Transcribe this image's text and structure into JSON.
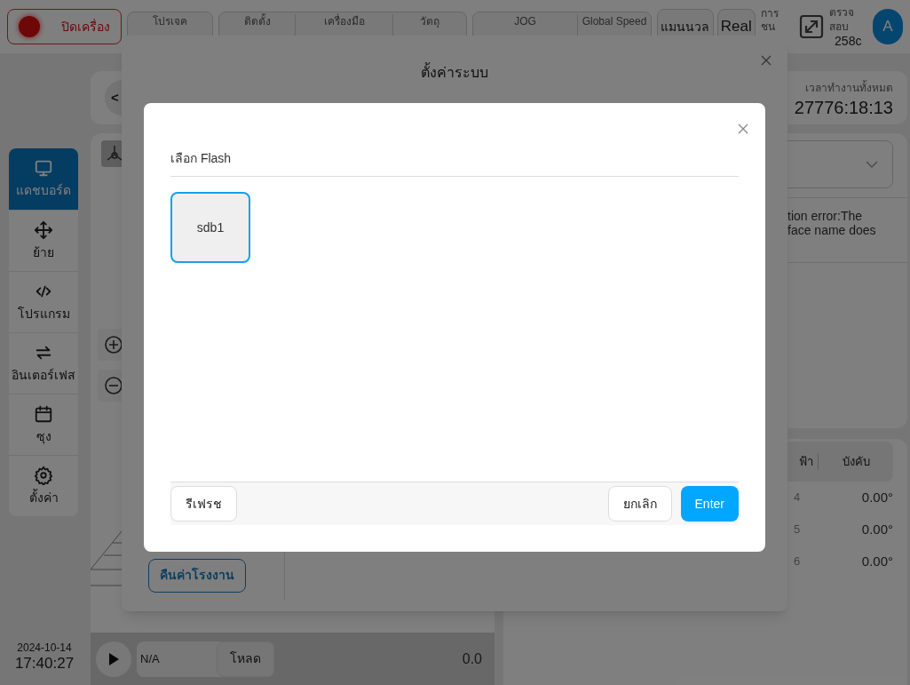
{
  "top_bar": {
    "power_button": "ปิดเครื่อง",
    "status_groups": [
      [
        {
          "label": "โปรเจค"
        }
      ],
      [
        {
          "label": "ติดตั้ง"
        },
        {
          "label": "เครื่องมือ"
        },
        {
          "label": "วัตถุ"
        }
      ],
      [
        {
          "label": "JOG"
        },
        {
          "label": "Global Speed"
        }
      ]
    ],
    "mode_button": "แมนนวล",
    "real_button": "Real",
    "collision": {
      "label": "การชน"
    },
    "inspect": {
      "label": "ตรวจสอบ",
      "value": "258c"
    },
    "avatar": "A"
  },
  "nav": [
    {
      "label": "แดชบอร์ด",
      "selected": true
    },
    {
      "label": "ย้าย",
      "selected": false
    },
    {
      "label": "โปรแกรม",
      "selected": false
    },
    {
      "label": "อินเตอร์เฟส",
      "selected": false
    },
    {
      "label": "ซุง",
      "selected": false
    },
    {
      "label": "ตั้งค่า",
      "selected": false
    }
  ],
  "datetime": {
    "date": "2024-10-14",
    "time": "17:40:27"
  },
  "back_button": "<",
  "player": {
    "field": "N/A",
    "load_button": "โหลด",
    "value": "0.0"
  },
  "runtime": {
    "label": "เวลาทำงานทั้งหมด",
    "value": "27776:18:13"
  },
  "message": "tion error:The\nface name does",
  "joints_table": {
    "columns": [
      "ฟ้า",
      "บังคับ"
    ],
    "rows": [
      {
        "cells": [
          "4",
          "0.00°"
        ]
      },
      {
        "cells": [
          "5",
          "0.00°"
        ]
      },
      {
        "cells": [
          "6",
          "0.00°"
        ]
      }
    ]
  },
  "settings_dialog": {
    "title": "ตั้งค่าระบบ",
    "factory_reset_button": "คืนค่าโรงงาน"
  },
  "flash_dialog": {
    "title": "เลือก Flash",
    "devices": [
      {
        "label": "sdb1",
        "selected": true
      }
    ],
    "refresh_button": "รีเฟรช",
    "cancel_button": "ยกเลิก",
    "enter_button": "Enter"
  }
}
